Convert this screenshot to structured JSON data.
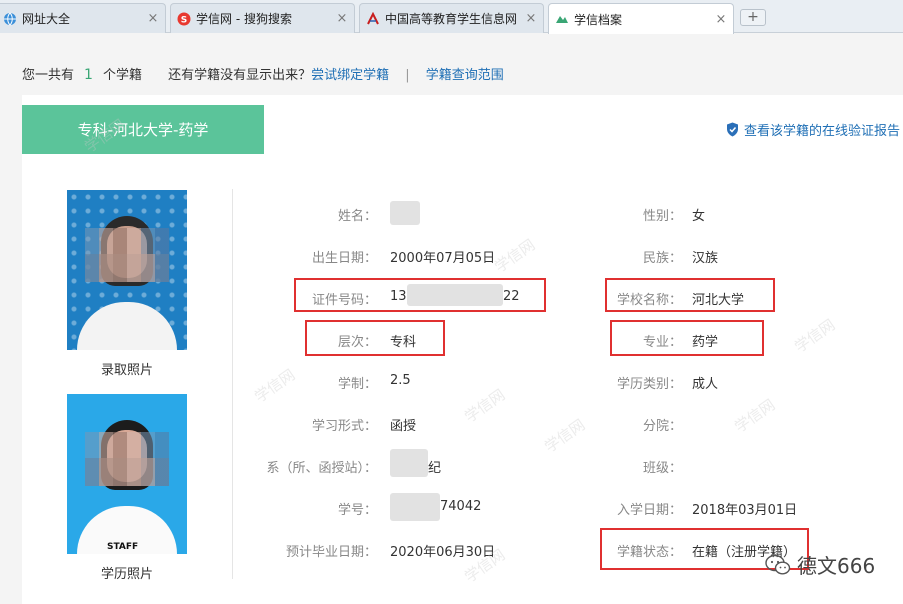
{
  "tabs": [
    {
      "label": "网址大全",
      "icon": "globe-icon",
      "active": false
    },
    {
      "label": "学信网 - 搜狗搜索",
      "icon": "sogou-s-icon",
      "active": false
    },
    {
      "label": "中国高等教育学生信息网",
      "icon": "chsi-logo-icon",
      "active": false
    },
    {
      "label": "学信档案",
      "icon": "chsi-green-icon",
      "active": true
    }
  ],
  "tab_close_glyph": "×",
  "new_tab_glyph": "+",
  "info": {
    "prefix": "您一共有",
    "count": "1",
    "suffix": "个学籍",
    "question": "还有学籍没有显示出来？",
    "bind_link": "尝试绑定学籍",
    "separator": "|",
    "scope_link": "学籍查询范围"
  },
  "header": {
    "title": "专科-河北大学-药学",
    "verify_link": "查看该学籍的在线验证报告"
  },
  "photos": {
    "admission_caption": "录取照片",
    "degree_caption": "学历照片",
    "shirt_text": "STAFF"
  },
  "fields_left": [
    {
      "label": "姓名：",
      "value": ""
    },
    {
      "label": "出生日期：",
      "value": "2000年07月05日"
    },
    {
      "label": "证件号码：",
      "value": "13",
      "value_tail": "22"
    },
    {
      "label": "层次：",
      "value": "专科"
    },
    {
      "label": "学制：",
      "value": "2.5"
    },
    {
      "label": "学习形式：",
      "value": "函授"
    },
    {
      "label": "系（所、函授站）：",
      "value": "纪"
    },
    {
      "label": "学号：",
      "value": "74042"
    },
    {
      "label": "预计毕业日期：",
      "value": "2020年06月30日"
    }
  ],
  "fields_right": [
    {
      "label": "性别：",
      "value": "女"
    },
    {
      "label": "民族：",
      "value": "汉族"
    },
    {
      "label": "学校名称：",
      "value": "河北大学"
    },
    {
      "label": "专业：",
      "value": "药学"
    },
    {
      "label": "学历类别：",
      "value": "成人"
    },
    {
      "label": "分院：",
      "value": ""
    },
    {
      "label": "班级：",
      "value": ""
    },
    {
      "label": "入学日期：",
      "value": "2018年03月01日"
    },
    {
      "label": "学籍状态：",
      "value": "在籍（注册学籍）"
    }
  ],
  "watermark_text": "学信网",
  "wechat_badge": "德文666",
  "colors": {
    "header_green": "#5bc49a",
    "link_blue": "#1f6fb5",
    "highlight_red": "#e03030",
    "count_green": "#3aa675"
  }
}
